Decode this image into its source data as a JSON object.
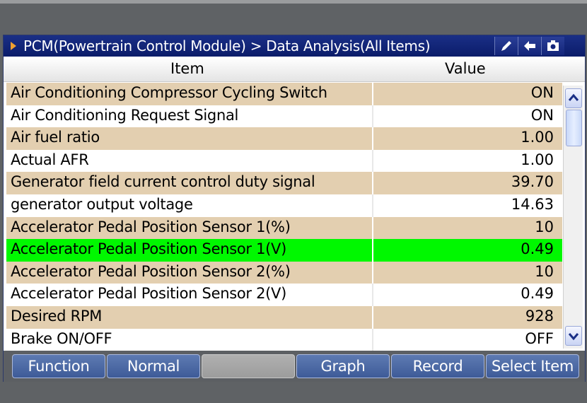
{
  "window": {
    "title": "PCM(Powertrain Control Module) > Data Analysis(All Items)",
    "tool_buttons": [
      {
        "name": "edit-button",
        "icon": "pen-icon"
      },
      {
        "name": "back-button",
        "icon": "back-arrow-icon"
      },
      {
        "name": "camera-button",
        "icon": "camera-icon"
      }
    ]
  },
  "table": {
    "headers": {
      "item": "Item",
      "value": "Value"
    },
    "rows": [
      {
        "item": "Air Conditioning Compressor Cycling Switch",
        "value": "ON"
      },
      {
        "item": "Air Conditioning Request Signal",
        "value": "ON"
      },
      {
        "item": "Air fuel ratio",
        "value": "1.00"
      },
      {
        "item": "Actual AFR",
        "value": "1.00"
      },
      {
        "item": "Generator field current control duty signal",
        "value": "39.70"
      },
      {
        "item": "generator output voltage",
        "value": "14.63"
      },
      {
        "item": "Accelerator Pedal Position Sensor 1(%)",
        "value": "10"
      },
      {
        "item": "Accelerator Pedal Position Sensor 1(V)",
        "value": "0.49"
      },
      {
        "item": "Accelerator Pedal Position Sensor 2(%)",
        "value": "10"
      },
      {
        "item": "Accelerator Pedal Position Sensor 2(V)",
        "value": "0.49"
      },
      {
        "item": "Desired RPM",
        "value": "928"
      },
      {
        "item": "Brake ON/OFF",
        "value": "OFF"
      }
    ],
    "selected_row_index": 7
  },
  "footer": {
    "buttons": [
      "Function",
      "Normal",
      "",
      "Graph",
      "Record",
      "Select Item"
    ]
  },
  "colors": {
    "title_bar": "#0b1c6a",
    "row_alt": "#e3cfb0",
    "row_selected": "#00f800",
    "button": "#4a67a4"
  }
}
